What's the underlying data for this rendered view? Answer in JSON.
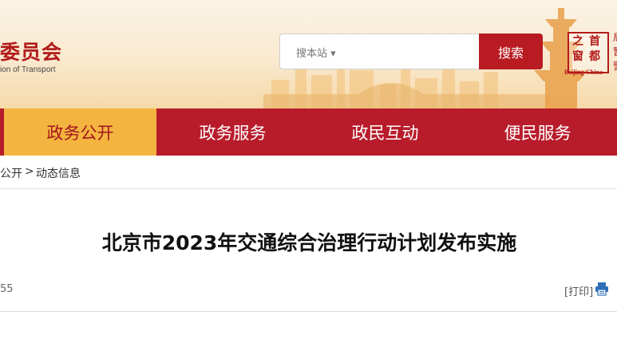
{
  "header": {
    "org_name_cn": "委员会",
    "org_name_en": "ion of Transport",
    "search": {
      "scope_label": "搜本站 ▾",
      "button_label": "搜索"
    },
    "seal": {
      "chars": [
        "首",
        "都",
        "之",
        "窗"
      ],
      "subtitle": "Beijing-China"
    },
    "edge_chars": [
      "局",
      "暂",
      "警"
    ]
  },
  "nav": {
    "items": [
      {
        "label": "政务公开",
        "active": true
      },
      {
        "label": "政务服务",
        "active": false
      },
      {
        "label": "政民互动",
        "active": false
      },
      {
        "label": "便民服务",
        "active": false
      }
    ]
  },
  "breadcrumb": {
    "parent": "公开",
    "separator": ">",
    "current": "动态信息"
  },
  "article": {
    "title": "北京市2023年交通综合治理行动计划发布实施",
    "meta_left": "55",
    "print_label": "[打印]"
  },
  "colors": {
    "brand_red": "#b81c2b",
    "active_tab": "#f4b540",
    "banner_bg": "#f9e9cf"
  }
}
